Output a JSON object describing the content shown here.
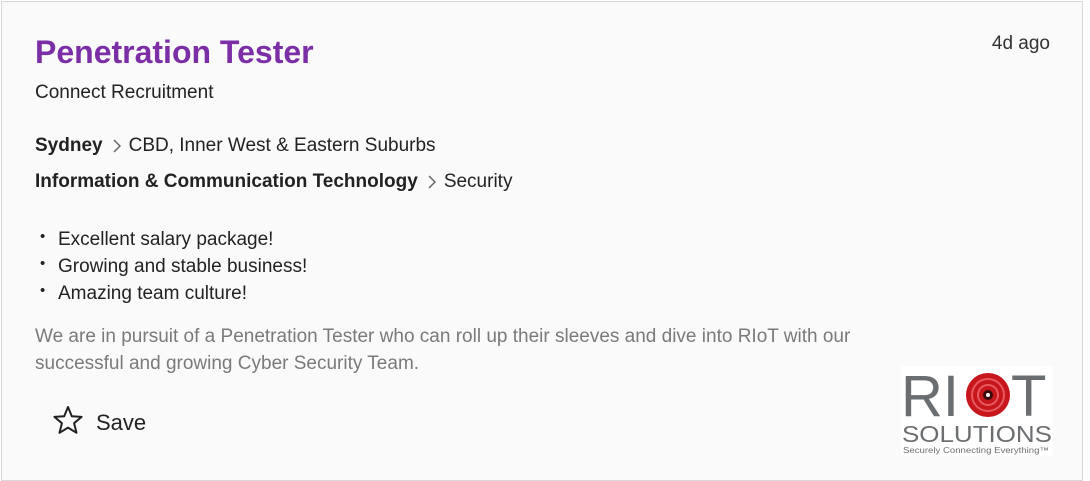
{
  "job": {
    "title": "Penetration Tester",
    "listed": "4d ago",
    "company": "Connect Recruitment",
    "location": {
      "city": "Sydney",
      "area": "CBD, Inner West & Eastern Suburbs"
    },
    "classification": {
      "main": "Information & Communication Technology",
      "sub": "Security"
    },
    "bullets": [
      "Excellent salary package!",
      "Growing and stable business!",
      "Amazing team culture!"
    ],
    "teaser": "We are in pursuit of a Penetration Tester who can roll up their sleeves and dive into RIoT with our successful and growing Cyber Security Team.",
    "save_label": "Save",
    "save_icon": "star-outline-icon"
  },
  "logo": {
    "letters_left": "RI",
    "letters_right": "T",
    "word": "SOLUTIONS",
    "tagline": "Securely Connecting Everything™"
  },
  "colors": {
    "title": "#7b2ea6",
    "teaser": "#7a7a7a",
    "logo_grey": "#6b6e70",
    "logo_red": "#c8161d"
  }
}
